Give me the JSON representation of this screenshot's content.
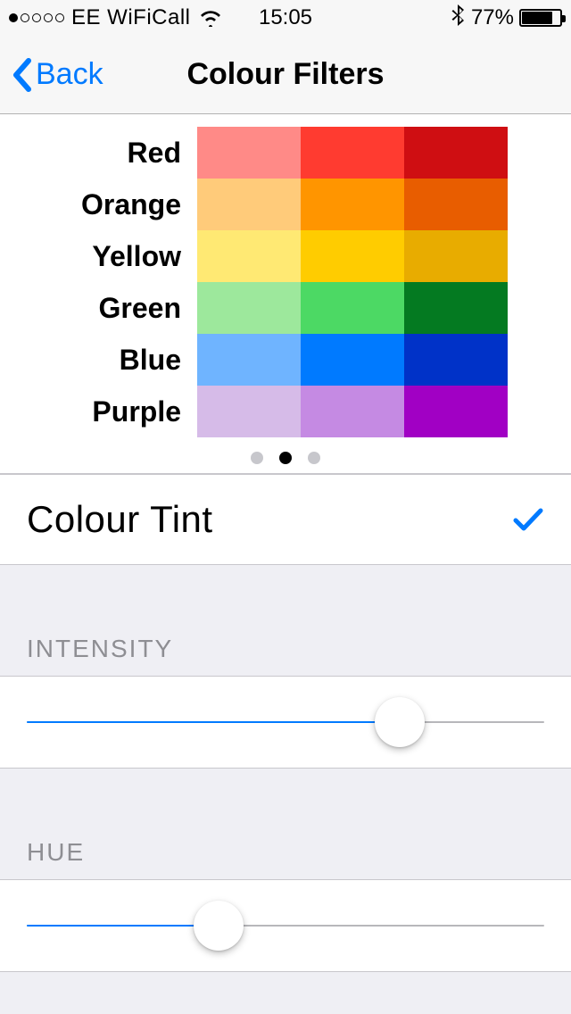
{
  "status_bar": {
    "carrier": "EE WiFiCall",
    "time": "15:05",
    "battery_percent": "77%",
    "battery_level": 77,
    "signal_dots": 1
  },
  "nav": {
    "back_label": "Back",
    "title": "Colour Filters"
  },
  "swatch_rows": [
    {
      "label": "Red",
      "shades": [
        "#ff8a87",
        "#ff3b30",
        "#cf0e12"
      ]
    },
    {
      "label": "Orange",
      "shades": [
        "#ffcb7a",
        "#ff9500",
        "#e85d00"
      ]
    },
    {
      "label": "Yellow",
      "shades": [
        "#ffe973",
        "#ffcc00",
        "#e8ac00"
      ]
    },
    {
      "label": "Green",
      "shades": [
        "#9de89c",
        "#4cd964",
        "#047a21"
      ]
    },
    {
      "label": "Blue",
      "shades": [
        "#6fb4ff",
        "#007aff",
        "#0032c8"
      ]
    },
    {
      "label": "Purple",
      "shades": [
        "#d6bbe8",
        "#c58ae3",
        "#a100c4"
      ]
    }
  ],
  "pager": {
    "count": 3,
    "active": 1
  },
  "selected_row": {
    "label": "Colour Tint",
    "checked": true
  },
  "sliders": {
    "intensity": {
      "header": "INTENSITY",
      "value": 72
    },
    "hue": {
      "header": "HUE",
      "value": 37
    }
  },
  "colors": {
    "accent": "#007aff"
  }
}
